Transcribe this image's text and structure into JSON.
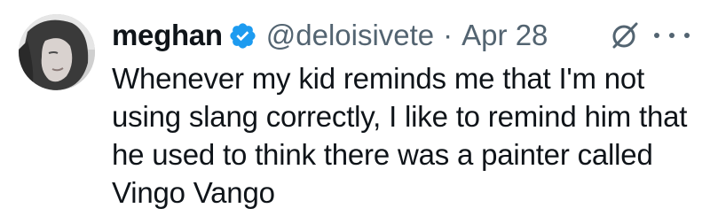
{
  "tweet": {
    "author": {
      "name": "meghan",
      "handle": "@deloisivete",
      "avatar_icon": "user-avatar",
      "verified_icon": "verified-badge-icon"
    },
    "separator": "·",
    "date": "Apr 28",
    "body_lines": [
      "Whenever my kid reminds me that I'm not",
      "using slang correctly, I like to remind him that",
      "he used to think there was a painter called",
      "Vingo Vango"
    ],
    "actions": {
      "grok_icon": "grok-icon",
      "more_icon": "more-options-icon"
    }
  },
  "colors": {
    "text_primary": "#0f1419",
    "text_secondary": "#536471",
    "verified_blue": "#1d9bf0",
    "background": "#ffffff"
  }
}
